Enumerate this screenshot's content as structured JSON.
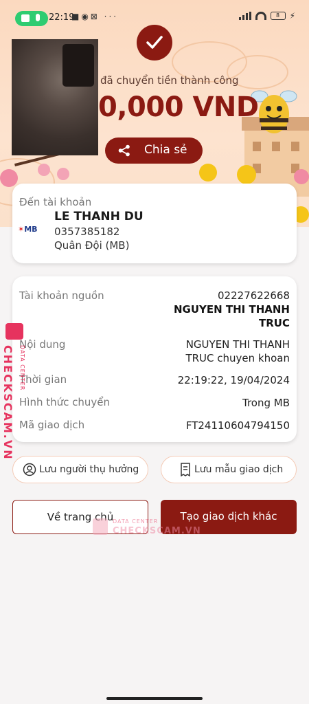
{
  "status_bar": {
    "time": "22:19",
    "battery": "8"
  },
  "hero": {
    "success_text": "đã chuyển tiền thành công",
    "amount": "0,000 VND",
    "share_label": "Chia sẻ"
  },
  "recipient": {
    "label": "Đến tài khoản",
    "name": "LE THANH DU",
    "account_number": "0357385182",
    "bank": "Quân Đội (MB)",
    "bank_logo": "MB"
  },
  "details": {
    "source_label": "Tài khoản nguồn",
    "source_account": "02227622668",
    "source_name_line1": "NGUYEN THI THANH",
    "source_name_line2": "TRUC",
    "content_label": "Nội dung",
    "content_line1": "NGUYEN THI THANH",
    "content_line2": "TRUC chuyen khoan",
    "time_label": "Thời gian",
    "time_value": "22:19:22, 19/04/2024",
    "method_label": "Hình thức chuyển",
    "method_value": "Trong MB",
    "txn_label": "Mã giao dịch",
    "txn_value": "FT24110604794150"
  },
  "actions": {
    "save_beneficiary": "Lưu người thụ hưởng",
    "save_template": "Lưu mẫu giao dịch",
    "home": "Về trang chủ",
    "new_transaction": "Tạo giao dịch khác"
  },
  "watermark": {
    "brand": "CHECKSCAM.VN",
    "tag": "DATA CENTER"
  },
  "colors": {
    "primary": "#8b1a12",
    "hero_bg": "#fbd9bf",
    "watermark": "#e6335e"
  }
}
